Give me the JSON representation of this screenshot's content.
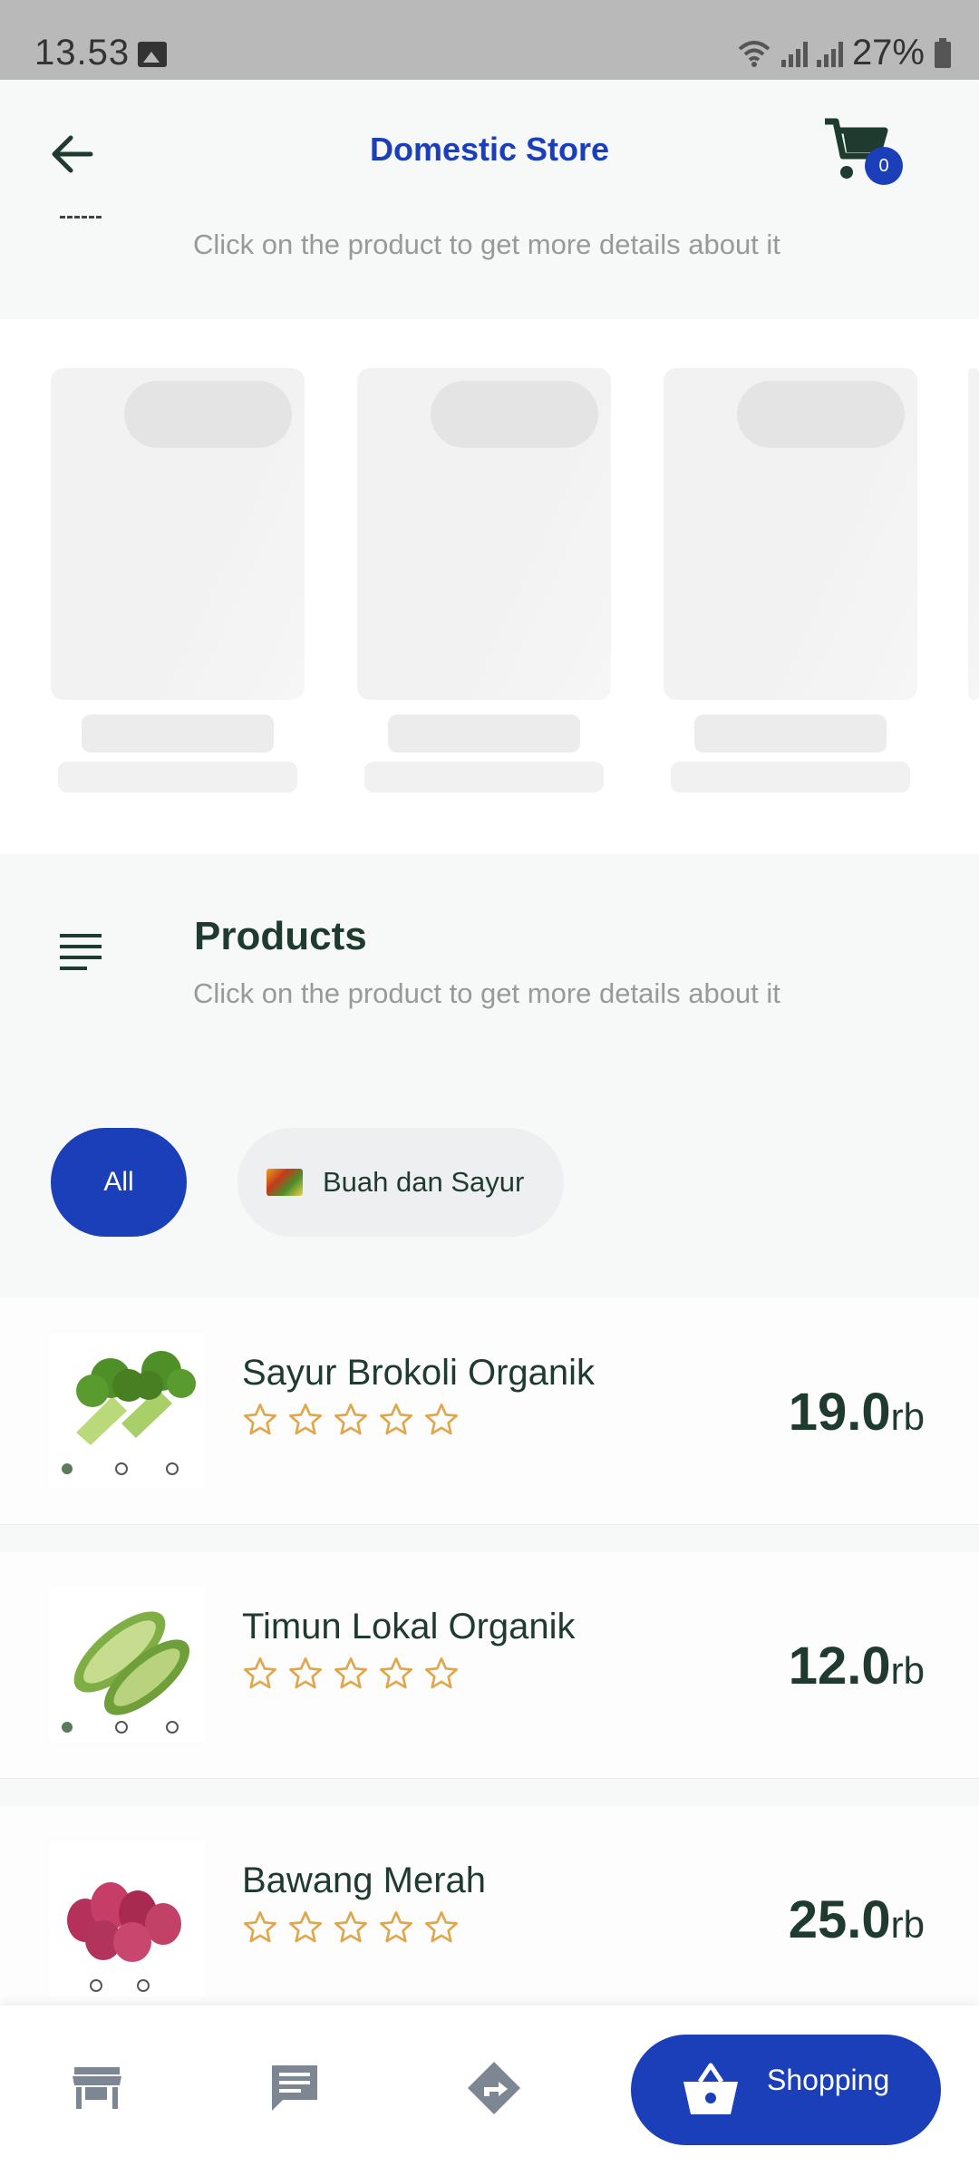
{
  "status_bar": {
    "time": "13.53",
    "battery": "27%"
  },
  "appbar": {
    "title": "Domestic Store",
    "cart_count": "0"
  },
  "top_section": {
    "subtitle": "Click on the product to get more details about it"
  },
  "products_section": {
    "title": "Products",
    "subtitle": "Click on the product to get more details about it",
    "filters": {
      "all_label": "All",
      "category_label": "Buah dan Sayur"
    }
  },
  "products": [
    {
      "name": "Sayur Brokoli Organik",
      "price": "19.0",
      "unit": "rb",
      "rating": 0
    },
    {
      "name": "Timun Lokal Organik",
      "price": "12.0",
      "unit": "rb",
      "rating": 0
    },
    {
      "name": "Bawang Merah",
      "price": "25.0",
      "unit": "rb",
      "rating": 0
    }
  ],
  "bottom_nav": {
    "shopping_label": "Shopping"
  },
  "colors": {
    "primary": "#1a3fb8",
    "text_dark": "#1f3a2f",
    "star": "#e0a64b",
    "icon_grey": "#7d8794"
  }
}
